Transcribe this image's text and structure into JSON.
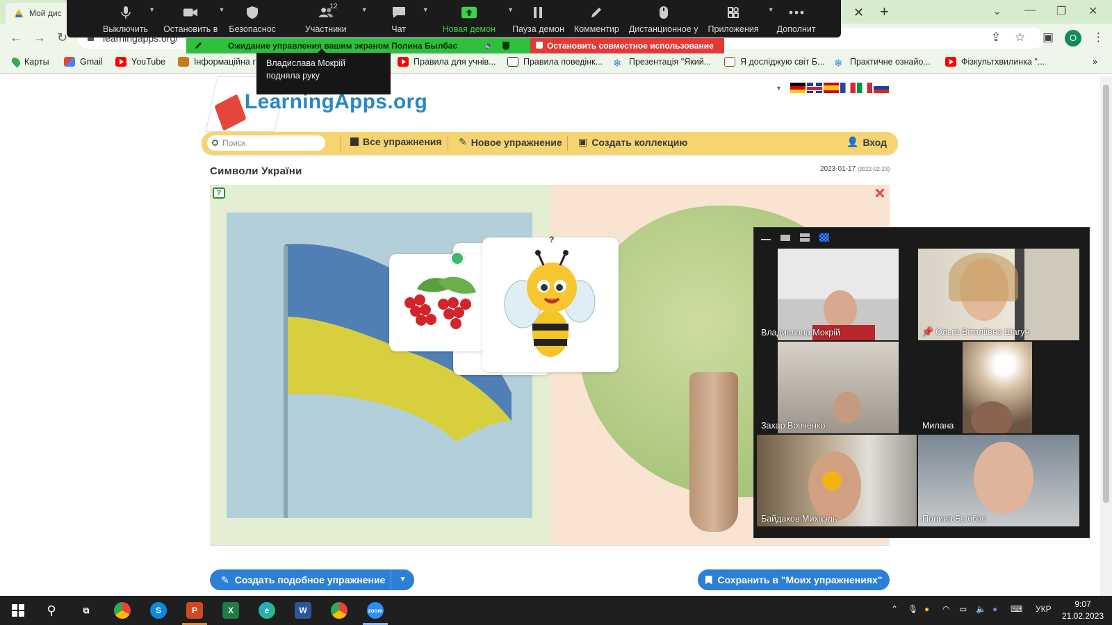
{
  "browser": {
    "tab_title": "Мой дис",
    "url": "learningapps.org/",
    "avatar_letter": "O",
    "accent": "#d7ebcf"
  },
  "zoom_toolbar": {
    "items": [
      {
        "label": "Выключить",
        "icon": "microphone-icon"
      },
      {
        "label": "Остановить в",
        "icon": "video-camera-icon"
      },
      {
        "label": "Безопаснос",
        "icon": "shield-icon"
      },
      {
        "label": "Участники",
        "icon": "participants-icon",
        "count": "12"
      },
      {
        "label": "Чат",
        "icon": "chat-icon"
      },
      {
        "label": "Новая демон",
        "icon": "share-screen-icon"
      },
      {
        "label": "Пауза демон",
        "icon": "pause-icon"
      },
      {
        "label": "Комментир",
        "icon": "pencil-icon"
      },
      {
        "label": "Дистанционное у",
        "icon": "mouse-icon"
      },
      {
        "label": "Приложения",
        "icon": "apps-icon"
      },
      {
        "label": "Дополнит",
        "icon": "more-icon"
      }
    ],
    "share_status": "Ожидание управления вашим экраном Полина Былбас",
    "stop_share": "Остановить совместное использование",
    "tooltip": "Владислава Мокрій подняла руку",
    "share_color": "#2fbf3e",
    "stop_color": "#e53935"
  },
  "bookmarks": [
    {
      "label": "Карты",
      "icon": "maps-pin-icon"
    },
    {
      "label": "Gmail",
      "icon": "gmail-icon"
    },
    {
      "label": "YouTube",
      "icon": "youtube-icon"
    },
    {
      "label": "Інформаційна г",
      "icon": "image-icon"
    },
    {
      "label": "Правила для учнів...",
      "icon": "youtube-icon"
    },
    {
      "label": "Правила поведінк...",
      "icon": "document-icon"
    },
    {
      "label": "Презентація \"Який...",
      "icon": "snowflake-icon"
    },
    {
      "label": "Я досліджую світ Б...",
      "icon": "book-icon"
    },
    {
      "label": "Практичне ознайо...",
      "icon": "snowflake-icon"
    },
    {
      "label": "Фізкультхвилинка \"...",
      "icon": "youtube-icon"
    }
  ],
  "site": {
    "logo": "LearningApps.org",
    "search_placeholder": "Поиск",
    "menu": {
      "all": "Все упражнения",
      "new": "Новое упражнение",
      "collection": "Создать коллекцию",
      "login": "Вход"
    },
    "menu_color": "#f6d471",
    "exercise_title": "Символи України",
    "date": "2023-01-17",
    "date_updated": "(2022-02-23)",
    "question_mark": "?",
    "create_similar": "Создать подобное упражнение",
    "save_to_mine": "Сохранить в \"Моих упражнениях\"",
    "button_color": "#2c7fd6"
  },
  "gallery": {
    "participants": [
      {
        "name": "Владислава Мокрій",
        "active": false
      },
      {
        "name": "Ольга Віталіївна Шагун",
        "active": true
      },
      {
        "name": "Захар Вовченко",
        "active": false
      },
      {
        "name": "Милана",
        "active": false
      },
      {
        "name": "Байдаков Михаэль",
        "active": false
      },
      {
        "name": "Полина Былбас",
        "active": false
      }
    ]
  },
  "taskbar": {
    "language": "УКР",
    "time": "9:07",
    "date": "21.02.2023"
  }
}
